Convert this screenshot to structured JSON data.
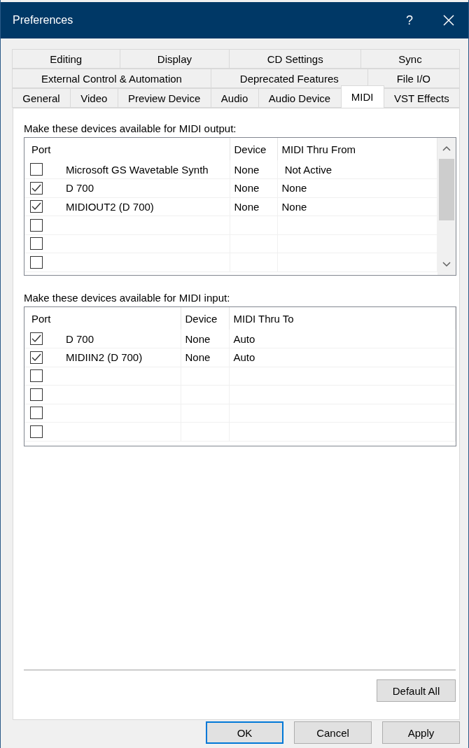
{
  "window": {
    "title": "Preferences",
    "help": "?"
  },
  "tabs": [
    [
      {
        "label": "Editing",
        "selected": false
      },
      {
        "label": "Display",
        "selected": false
      },
      {
        "label": "CD Settings",
        "selected": false
      },
      {
        "label": "Sync",
        "selected": false
      }
    ],
    [
      {
        "label": "External Control & Automation",
        "selected": false
      },
      {
        "label": "Deprecated Features",
        "selected": false
      },
      {
        "label": "File I/O",
        "selected": false
      }
    ],
    [
      {
        "label": "General",
        "selected": false
      },
      {
        "label": "Video",
        "selected": false
      },
      {
        "label": "Preview Device",
        "selected": false
      },
      {
        "label": "Audio",
        "selected": false
      },
      {
        "label": "Audio Device",
        "selected": false
      },
      {
        "label": "MIDI",
        "selected": true
      },
      {
        "label": "VST Effects",
        "selected": false
      }
    ]
  ],
  "output_section": {
    "label": "Make these devices available for MIDI output:",
    "columns": [
      "Port",
      "Device",
      "MIDI Thru From"
    ],
    "rows": [
      {
        "checked": false,
        "port": "Microsoft GS Wavetable Synth",
        "device": "None",
        "thru": " Not Active"
      },
      {
        "checked": true,
        "port": "D 700",
        "device": "None",
        "thru": "None"
      },
      {
        "checked": true,
        "port": "MIDIOUT2 (D 700)",
        "device": "None",
        "thru": "None"
      },
      {
        "checked": false
      },
      {
        "checked": false
      },
      {
        "checked": false
      }
    ]
  },
  "input_section": {
    "label": "Make these devices available for MIDI input:",
    "columns": [
      "Port",
      "Device",
      "MIDI Thru To"
    ],
    "rows": [
      {
        "checked": true,
        "port": "D 700",
        "device": "None",
        "thru": "Auto"
      },
      {
        "checked": true,
        "port": "MIDIIN2 (D 700)",
        "device": "None",
        "thru": "Auto"
      },
      {
        "checked": false
      },
      {
        "checked": false
      },
      {
        "checked": false
      },
      {
        "checked": false
      }
    ]
  },
  "default_all": "Default All",
  "buttons": [
    {
      "label": "OK",
      "default": true
    },
    {
      "label": "Cancel",
      "default": false
    },
    {
      "label": "Apply",
      "default": false
    }
  ]
}
